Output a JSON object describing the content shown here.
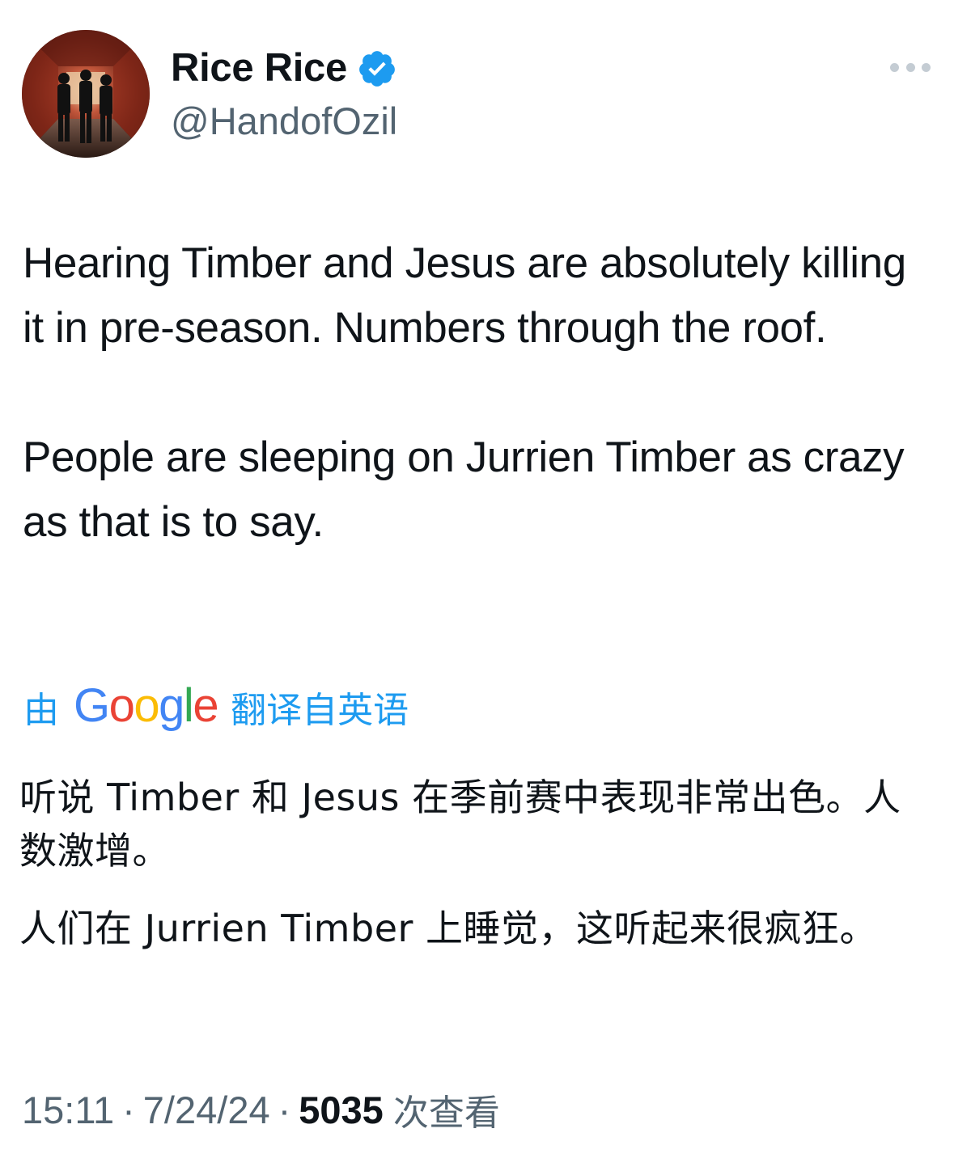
{
  "author": {
    "display_name": "Rice Rice",
    "handle": "@HandofOzil",
    "verified": true
  },
  "icons": {
    "avatar": "avatar-photo",
    "verified": "verified-badge-icon",
    "more": "more-options-icon"
  },
  "tweet": {
    "paragraphs": [
      "Hearing Timber and Jesus are absolutely killing it in pre-season. Numbers through the roof.",
      "People are sleeping on Jurrien Timber as crazy as that is to say."
    ]
  },
  "translation": {
    "prefix": "由",
    "provider": "Google",
    "suffix": "翻译自英语",
    "paragraphs": [
      "听说 Timber 和 Jesus 在季前赛中表现非常出色。人数激增。",
      "人们在 Jurrien Timber 上睡觉，这听起来很疯狂。"
    ]
  },
  "meta": {
    "time": "15:11",
    "separator": "·",
    "date": "7/24/24",
    "views_count": "5035",
    "views_label": "次查看"
  },
  "colors": {
    "accent": "#1d9bf0",
    "text_primary": "#0f1419",
    "text_secondary": "#536471",
    "google_blue": "#4285F4",
    "google_red": "#EA4335",
    "google_yellow": "#FBBC05",
    "google_green": "#34A853"
  }
}
